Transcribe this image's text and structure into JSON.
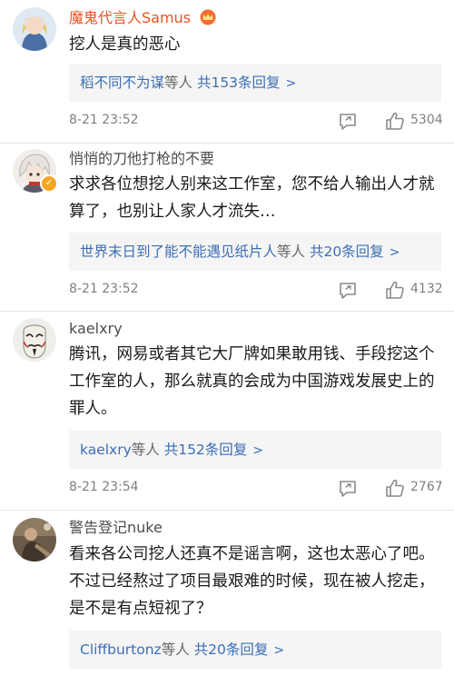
{
  "comments": [
    {
      "username": "魔鬼代言人Samus",
      "content": "挖人是真的恶心",
      "replies": {
        "user": "稻不同不为谋",
        "mid": "等人 ",
        "count": "共153条回复",
        "arrow": ">"
      },
      "time": "8-21 23:52",
      "likes": "5304"
    },
    {
      "username": "悄悄的刀他打枪的不要",
      "content": "求求各位想挖人别来这工作室，您不给人输出人才就算了，也别让人家人才流失…",
      "replies": {
        "user": "世界末日到了能不能遇见纸片人",
        "mid": "等人 ",
        "count": "共20条回复",
        "arrow": ">"
      },
      "time": "8-21 23:52",
      "likes": "4132"
    },
    {
      "username": "kaelxry",
      "content": "腾讯，网易或者其它大厂牌如果敢用钱、手段挖这个工作室的人，那么就真的会成为中国游戏发展史上的罪人。",
      "replies": {
        "user": "kaelxry",
        "mid": "等人 ",
        "count": "共152条回复",
        "arrow": ">"
      },
      "time": "8-21 23:54",
      "likes": "2767"
    },
    {
      "username": "警告登记nuke",
      "content": "看来各公司挖人还真不是谣言啊，这也太恶心了吧。不过已经熬过了项目最艰难的时候，现在被人挖走，是不是有点短视了？",
      "replies": {
        "user": "Cliffburtonz",
        "mid": "等人 ",
        "count": "共20条回复",
        "arrow": ">"
      }
    }
  ],
  "colors": {
    "vip_name": "#e8541e",
    "link_blue": "#3b6eb5",
    "meta_gray": "#808080",
    "verify_badge": "#f5a623"
  },
  "icons": [
    "crown-icon",
    "verified-badge-icon",
    "share-icon",
    "comment-icon",
    "like-icon",
    "chevron-right-icon"
  ]
}
